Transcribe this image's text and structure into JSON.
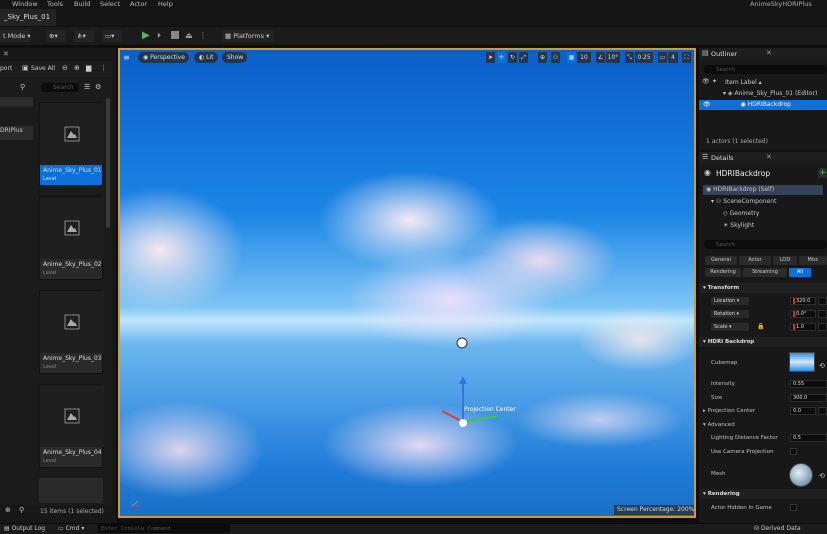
{
  "menubar": {
    "items": [
      "Window",
      "Tools",
      "Build",
      "Select",
      "Actor",
      "Help"
    ],
    "project": "AnimeSkyHDRIPlus"
  },
  "tab": {
    "title": "_Sky_Plus_01"
  },
  "toolbar": {
    "mode": "t Mode",
    "platforms": "Platforms"
  },
  "content_browser": {
    "import_label": "port",
    "save_all": "Save All",
    "search_placeholder": "Search",
    "folder": "DRIPlus",
    "assets": [
      {
        "name": "Anime_Sky_Plus_01",
        "type": "Level",
        "selected": true
      },
      {
        "name": "Anime_Sky_Plus_02",
        "type": "Level",
        "selected": false
      },
      {
        "name": "Anime_Sky_Plus_03",
        "type": "Level",
        "selected": false
      },
      {
        "name": "Anime_Sky_Plus_04",
        "type": "Level",
        "selected": false
      }
    ],
    "status": "15 items (1 selected)"
  },
  "viewport": {
    "perspective": "Perspective",
    "lit": "Lit",
    "show": "Show",
    "grid_snap": "10",
    "rot_snap": "10°",
    "scale_snap": "0.25",
    "cam_speed": "4",
    "gizmo_label": "Projection Center",
    "screen_pct": "Screen Percentage: 200%"
  },
  "outliner": {
    "title": "Outliner",
    "search_placeholder": "Search",
    "col_label": "Item Label",
    "world": "Anime_Sky_Plus_01 (Editor)",
    "actor": "HDRIBackdrop",
    "count": "1 actors (1 selected)"
  },
  "details": {
    "title": "Details",
    "actor": "HDRIBackdrop",
    "components": [
      "HDRIBackdrop (Self)",
      "SceneComponent",
      "Geometry",
      "Skylight"
    ],
    "search_placeholder": "Search",
    "filters": [
      "General",
      "Actor",
      "LOD",
      "Misc",
      "Rendering",
      "Streaming",
      "All"
    ],
    "transform": {
      "title": "Transform",
      "location_label": "Location",
      "location_x": "320.0",
      "rotation_label": "Rotation",
      "rotation_x": "0.0°",
      "scale_label": "Scale",
      "scale_x": "1.0"
    },
    "hdri": {
      "title": "HDRI Backdrop",
      "cubemap": "Cubemap",
      "intensity_label": "Intensity",
      "intensity": "0.55",
      "size_label": "Size",
      "size": "300.0",
      "projection_label": "Projection Center",
      "projection_x": "0.0",
      "advanced": "Advanced",
      "lighting_label": "Lighting Distance Factor",
      "lighting": "0.5",
      "camera_proj": "Use Camera Projection",
      "mesh": "Mesh"
    },
    "rendering": {
      "title": "Rendering",
      "hidden": "Actor Hidden In Game"
    }
  },
  "statusbar": {
    "output_log": "Output Log",
    "cmd": "Cmd",
    "console_placeholder": "Enter Console Command",
    "derived": "Derived Data"
  },
  "colors": {
    "accent": "#0f6fd8",
    "viewport_border": "#d79a2a",
    "play": "#5cb85c"
  }
}
